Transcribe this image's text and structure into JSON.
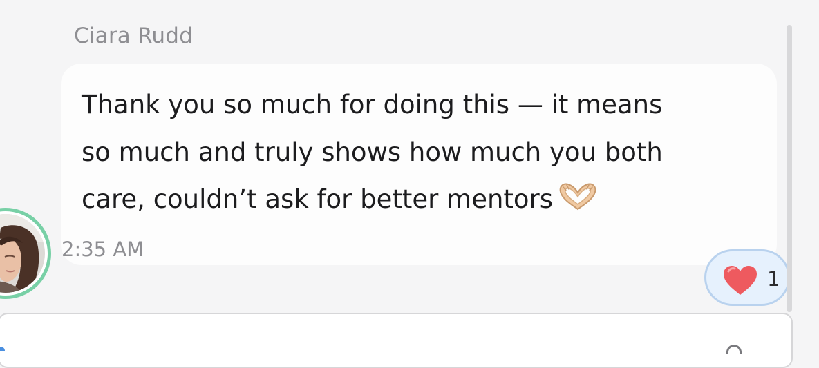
{
  "message": {
    "sender": "Ciara Rudd",
    "text": "Thank you so much for doing this — it means\nso much and truly shows how much you both\ncare, couldn’t ask for better mentors",
    "emoji": "heart-hands-icon",
    "timestamp": "2:35 AM"
  },
  "reaction": {
    "emoji": "heart-icon",
    "count": "1"
  },
  "colors": {
    "avatar_ring": "#78d0a6",
    "reaction_bg": "#e6f1fd",
    "reaction_border": "#b9d2ee",
    "heart": "#ee5a5f"
  }
}
